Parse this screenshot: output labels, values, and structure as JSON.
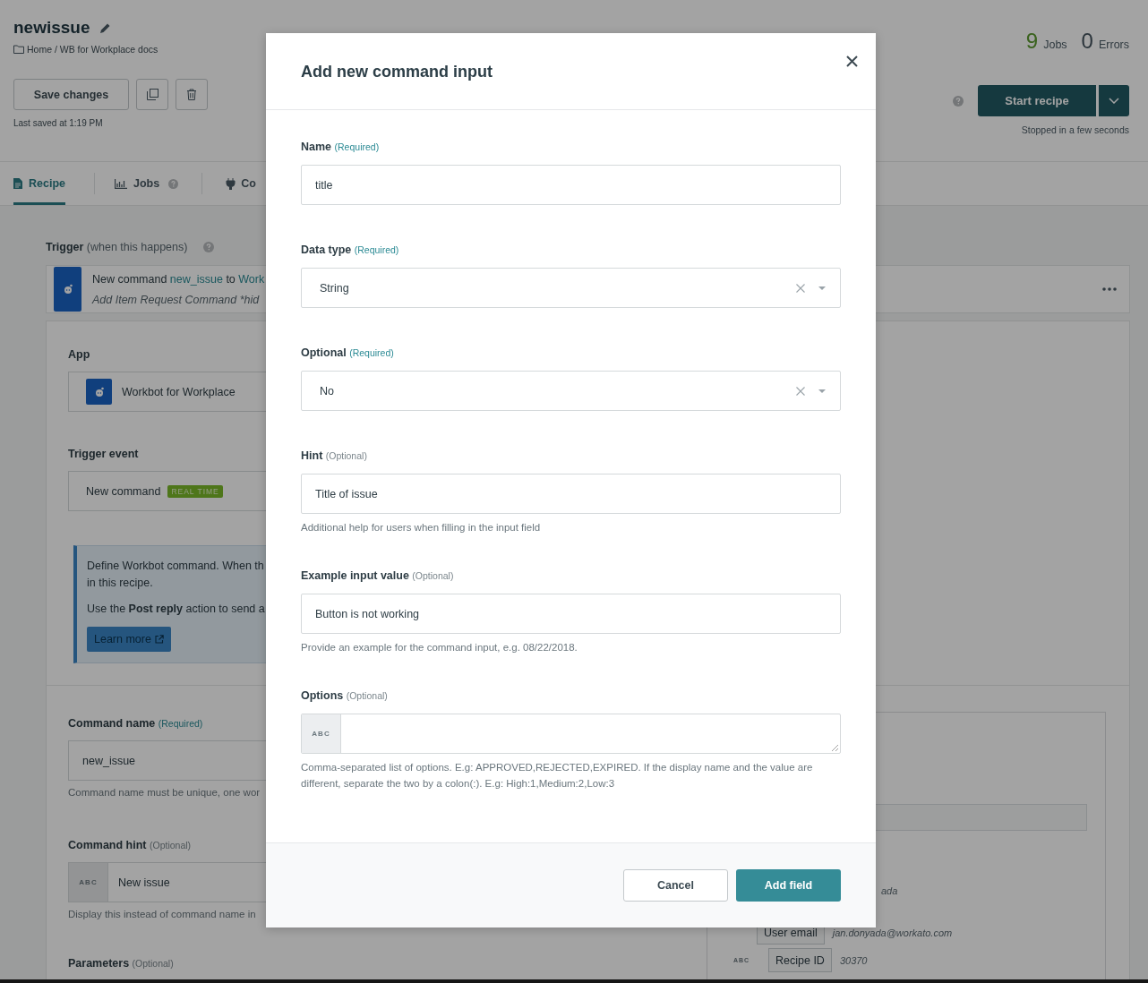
{
  "header": {
    "title": "newissue",
    "breadcrumb": "Home / WB for Workplace docs",
    "save_button": "Save changes",
    "last_saved": "Last saved at 1:19 PM"
  },
  "stats": [
    {
      "count": "9",
      "label": "Jobs",
      "kind": "success"
    },
    {
      "count": "0",
      "label": "Errors",
      "kind": "error"
    }
  ],
  "start_button": "Start recipe",
  "status": "Stopped in a few seconds",
  "tabs": [
    {
      "label": "Recipe",
      "selected": true
    },
    {
      "label": "Jobs",
      "selected": false
    },
    {
      "label": "Co",
      "selected": false
    }
  ],
  "trigger": {
    "heading": "Trigger",
    "note": "(when this happens)",
    "summary": [
      {
        "text": "New command ",
        "highlight": false
      },
      {
        "text": "new_issue",
        "highlight": true
      },
      {
        "text": " to ",
        "highlight": false
      },
      {
        "text": "Work",
        "highlight": true
      }
    ],
    "description": "Add Item Request Command *hid"
  },
  "app_field": {
    "label": "App",
    "value": "Workbot for Workplace"
  },
  "event_field": {
    "label": "Trigger event",
    "value": "New command",
    "badge": "REAL TIME"
  },
  "info": {
    "lines": [
      "Define Workbot command. When th",
      "in this recipe."
    ],
    "note": "Use the **Post reply** action to send a",
    "button": "Learn more"
  },
  "command_fields": [
    {
      "label": "Command name",
      "requirement": "(Required)",
      "required": true,
      "value": "new_issue",
      "helper": "Command name must be unique, one wor"
    },
    {
      "label": "Command hint",
      "requirement": "(Optional)",
      "required": false,
      "prefix": "ABC",
      "value": "New issue",
      "helper": "Display this instead of command name in"
    }
  ],
  "parameters": {
    "label": "Parameters",
    "requirement": "(Optional)"
  },
  "output_rows": [
    {
      "value": "ada"
    },
    {
      "label": "User email",
      "value": "jan.donyada@workato.com"
    },
    {
      "prefix": "ABC",
      "label": "Recipe ID",
      "value": "30370"
    }
  ],
  "modal": {
    "title": "Add new command input",
    "fields": [
      {
        "kind": "input",
        "label": "Name",
        "requirement": "(Required)",
        "required": true,
        "value": "title"
      },
      {
        "kind": "select",
        "label": "Data type",
        "requirement": "(Required)",
        "required": true,
        "value": "String"
      },
      {
        "kind": "select",
        "label": "Optional",
        "requirement": "(Required)",
        "required": true,
        "value": "No"
      },
      {
        "kind": "input",
        "label": "Hint",
        "requirement": "(Optional)",
        "required": false,
        "value": "Title of issue",
        "helper": "Additional help for users when filling in the input field"
      },
      {
        "kind": "input",
        "label": "Example input value",
        "requirement": "(Optional)",
        "required": false,
        "value": "Button is not working",
        "helper": "Provide an example for the command input, e.g. 08/22/2018."
      },
      {
        "kind": "textarea",
        "label": "Options",
        "requirement": "(Optional)",
        "required": false,
        "prefix": "ABC",
        "helper": "Comma-separated list of options. E.g: APPROVED,REJECTED,EXPIRED. If the display name and the value are different, separate the two by a colon(:). E.g: High:1,Medium:2,Low:3"
      }
    ],
    "cancel": "Cancel",
    "submit": "Add field"
  }
}
